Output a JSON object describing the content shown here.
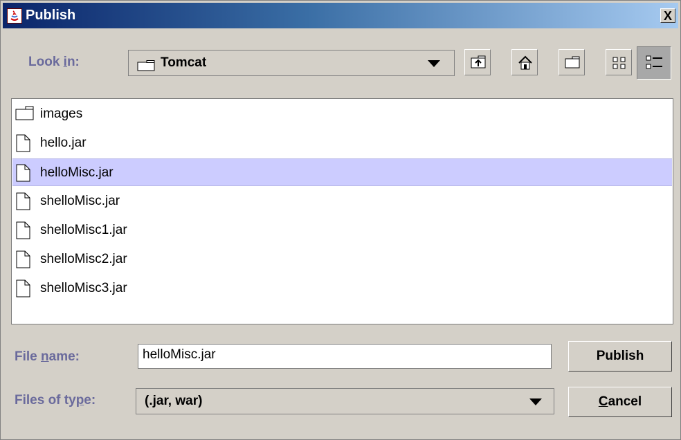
{
  "window": {
    "title": "Publish",
    "close_label": "X"
  },
  "look_in": {
    "label_prefix": "Look ",
    "label_mnemonic": "i",
    "label_suffix": "n:",
    "selected": "Tomcat"
  },
  "toolbar": {
    "buttons": [
      "up-one-level-icon",
      "home-icon",
      "new-folder-icon",
      "list-view-icon",
      "details-view-icon"
    ],
    "pressed": "details-view"
  },
  "files": [
    {
      "name": "images",
      "type": "folder"
    },
    {
      "name": "hello.jar",
      "type": "file"
    },
    {
      "name": "helloMisc.jar",
      "type": "file",
      "selected": true
    },
    {
      "name": "shelloMisc.jar",
      "type": "file"
    },
    {
      "name": "shelloMisc1.jar",
      "type": "file"
    },
    {
      "name": "shelloMisc2.jar",
      "type": "file"
    },
    {
      "name": "shelloMisc3.jar",
      "type": "file"
    }
  ],
  "file_name": {
    "label_prefix": "File ",
    "label_mnemonic": "n",
    "label_suffix": "ame:",
    "value": "helloMisc.jar"
  },
  "file_type": {
    "label_prefix": "Files of ty",
    "label_mnemonic": "p",
    "label_suffix": "e:",
    "selected": "(.jar, war)"
  },
  "buttons": {
    "publish": "Publish",
    "cancel_mnemonic": "C",
    "cancel_rest": "ancel"
  },
  "colors": {
    "selection": "#ccccff",
    "label": "#6a6a9c",
    "title_start": "#0a246a",
    "title_end": "#a6caf0"
  }
}
